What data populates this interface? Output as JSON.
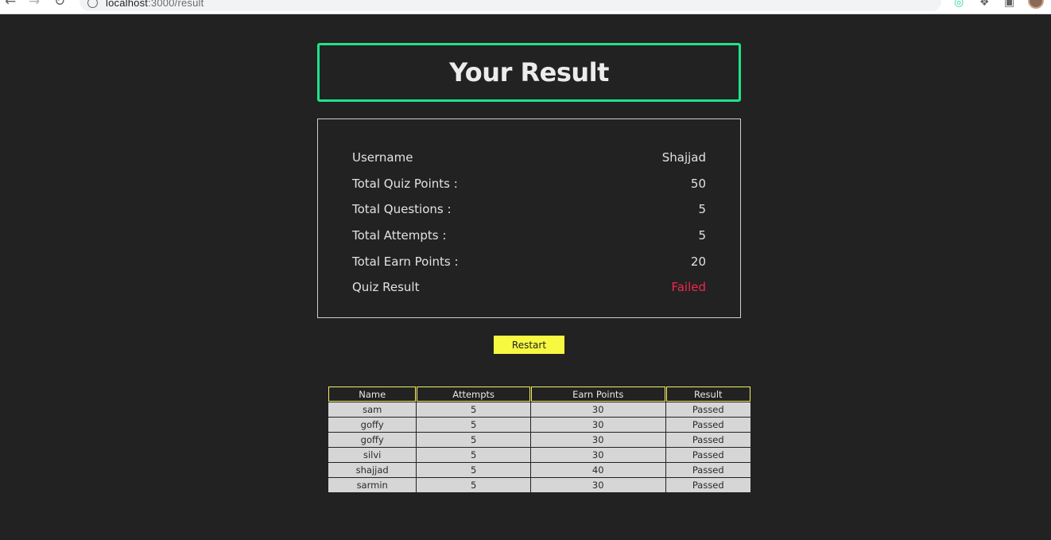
{
  "browser": {
    "url_host": "localhost",
    "url_rest": ":3000/result"
  },
  "page": {
    "title": "Your Result"
  },
  "summary": [
    {
      "label": "Username",
      "value": "Shajjad"
    },
    {
      "label": "Total Quiz Points :",
      "value": "50"
    },
    {
      "label": "Total Questions :",
      "value": "5"
    },
    {
      "label": "Total Attempts :",
      "value": "5"
    },
    {
      "label": "Total Earn Points :",
      "value": "20"
    },
    {
      "label": "Quiz Result",
      "value": "Failed"
    }
  ],
  "restart_label": "Restart",
  "table": {
    "headers": [
      "Name",
      "Attempts",
      "Earn Points",
      "Result"
    ],
    "rows": [
      [
        "sam",
        "5",
        "30",
        "Passed"
      ],
      [
        "goffy",
        "5",
        "30",
        "Passed"
      ],
      [
        "goffy",
        "5",
        "30",
        "Passed"
      ],
      [
        "silvi",
        "5",
        "30",
        "Passed"
      ],
      [
        "shajjad",
        "5",
        "40",
        "Passed"
      ],
      [
        "sarmin",
        "5",
        "30",
        "Passed"
      ]
    ]
  },
  "colors": {
    "background": "#222222",
    "title_border": "#1fe38a",
    "failed": "#f0264f",
    "button": "#f7f840",
    "table_header_border": "#f0f060"
  }
}
